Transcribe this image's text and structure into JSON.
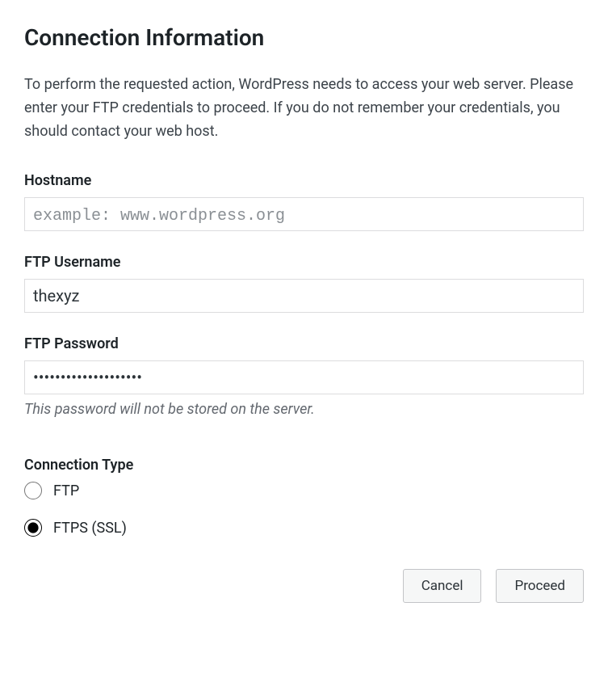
{
  "heading": "Connection Information",
  "description": "To perform the requested action, WordPress needs to access your web server. Please enter your FTP credentials to proceed. If you do not remember your credentials, you should contact your web host.",
  "fields": {
    "hostname": {
      "label": "Hostname",
      "placeholder": "example: www.wordpress.org",
      "value": ""
    },
    "username": {
      "label": "FTP Username",
      "value": "thexyz"
    },
    "password": {
      "label": "FTP Password",
      "value": "••••••••••••••••••••",
      "help": "This password will not be stored on the server."
    }
  },
  "connectionType": {
    "heading": "Connection Type",
    "options": {
      "ftp": "FTP",
      "ftps": "FTPS (SSL)"
    },
    "selected": "ftps"
  },
  "buttons": {
    "cancel": "Cancel",
    "proceed": "Proceed"
  }
}
